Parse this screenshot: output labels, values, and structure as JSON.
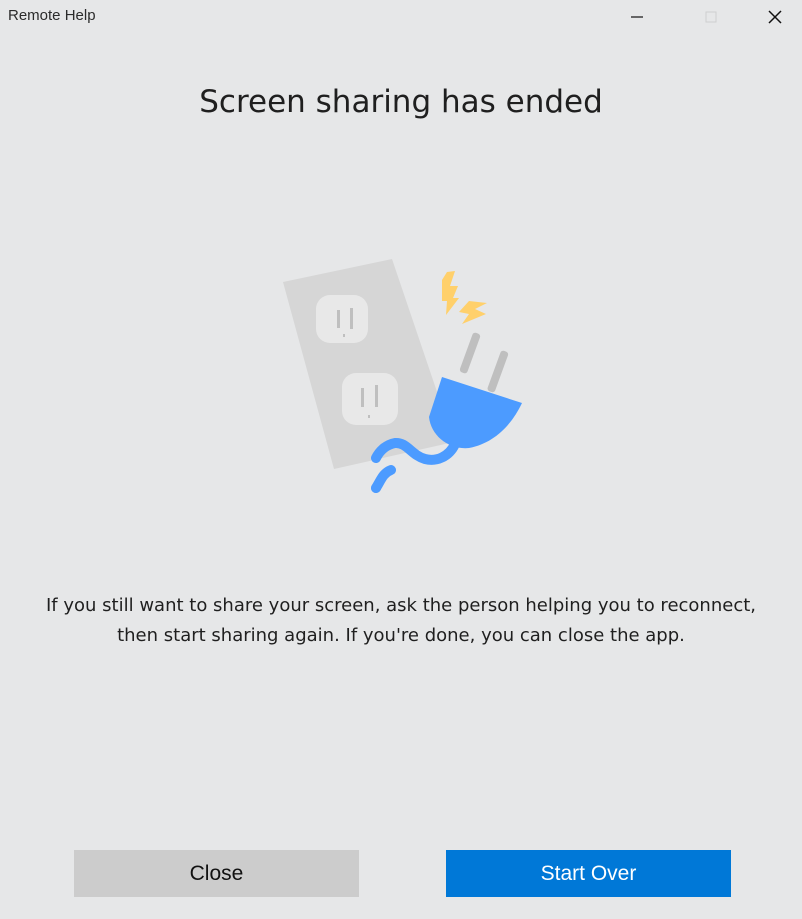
{
  "window": {
    "title": "Remote Help",
    "controls": {
      "minimize": "minimize-icon",
      "maximize": "maximize-icon",
      "close": "close-icon"
    }
  },
  "content": {
    "heading": "Screen sharing has ended",
    "message": "If you still want to share your screen, ask the person helping you to reconnect, then start sharing again. If you're done, you can close the app.",
    "illustration": {
      "icons": [
        "outlet-icon",
        "plug-icon",
        "spark-icon"
      ],
      "colors": {
        "outlet": "#d6d6d6",
        "socket": "#e8e8e8",
        "plug": "#4c9bff",
        "spark": "#ffd06b",
        "prongs": "#bfbfbf"
      }
    }
  },
  "actions": {
    "close_label": "Close",
    "start_over_label": "Start Over",
    "colors": {
      "secondary": "#cccccc",
      "primary": "#0078d7",
      "primary_text": "#ffffff"
    }
  }
}
